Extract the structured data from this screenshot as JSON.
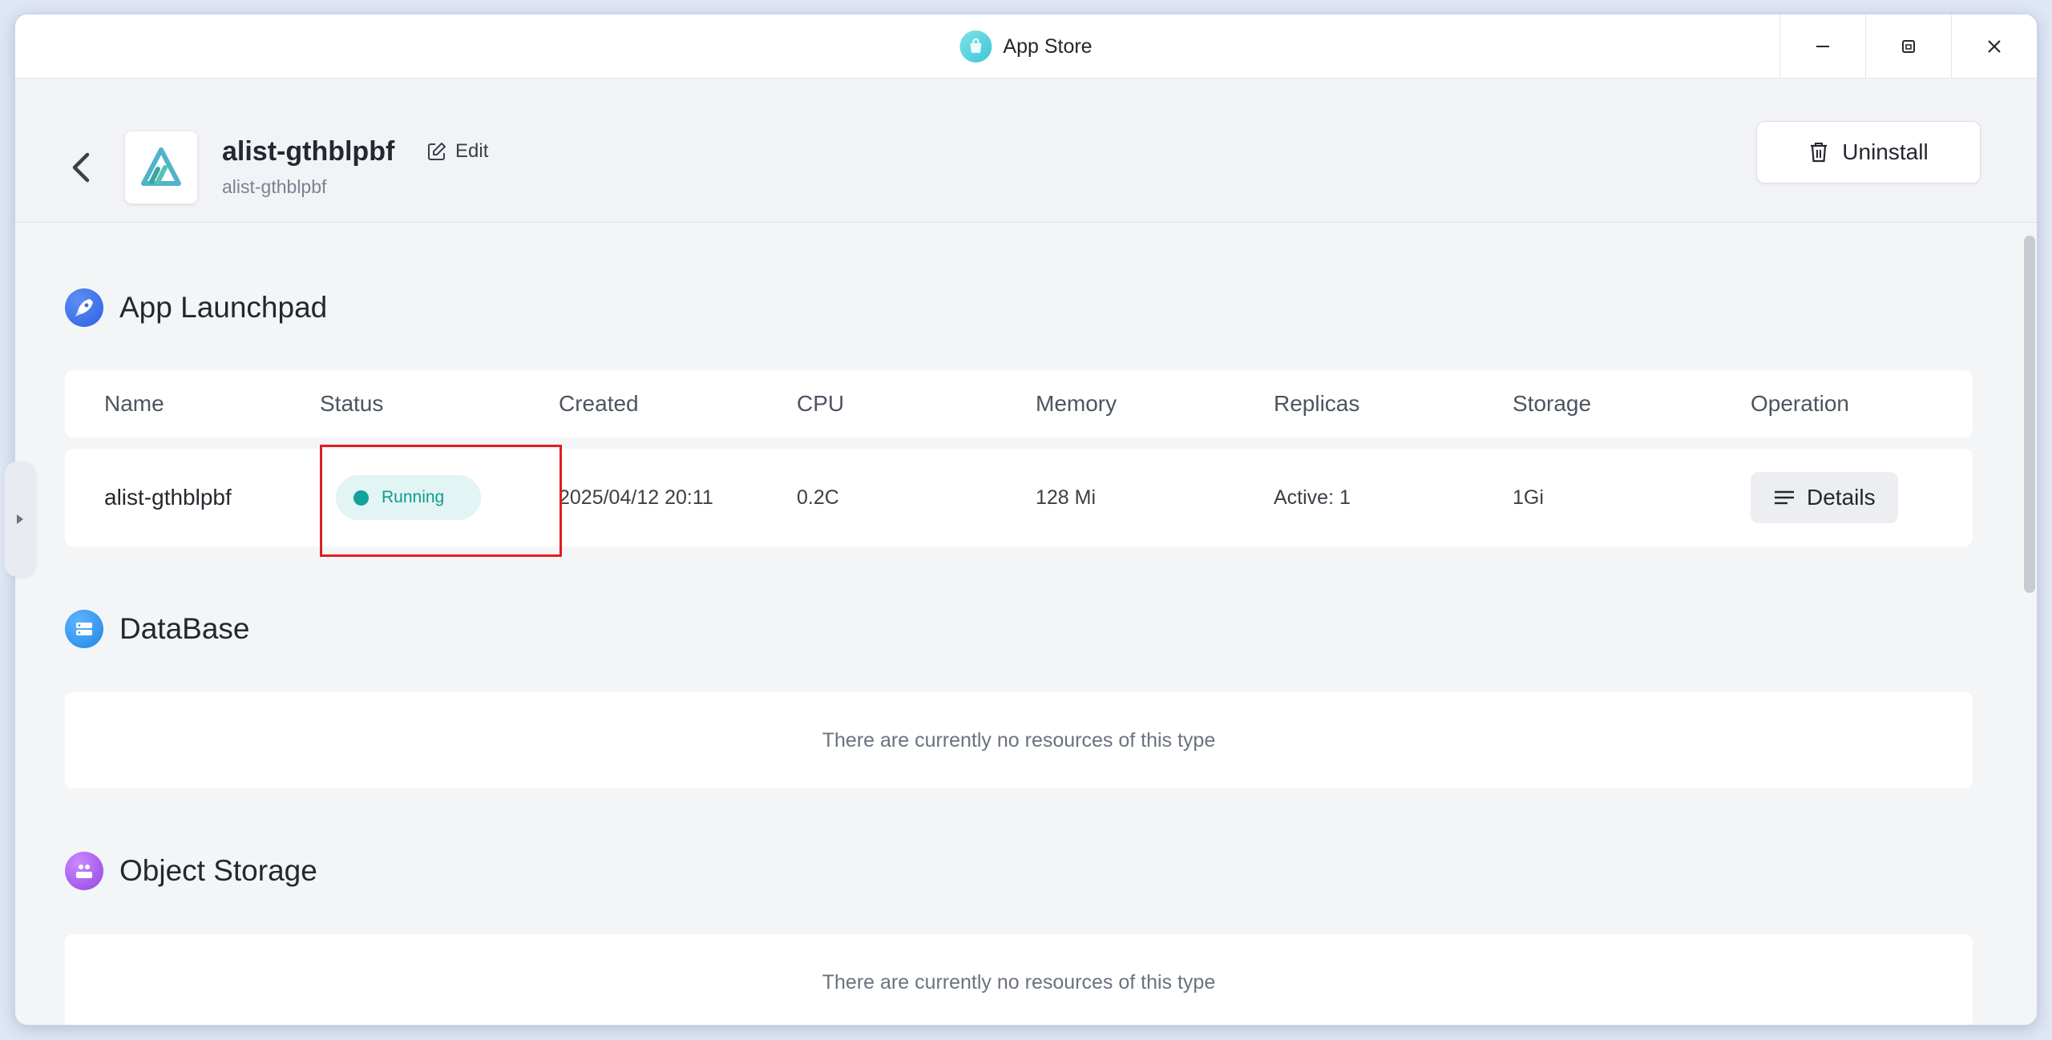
{
  "window": {
    "title": "App Store",
    "icon": "shopping-bag-icon"
  },
  "header": {
    "app_name": "alist-gthblpbf",
    "app_subtitle": "alist-gthblpbf",
    "edit_label": "Edit",
    "uninstall_label": "Uninstall"
  },
  "launchpad": {
    "title": "App Launchpad",
    "columns": [
      "Name",
      "Status",
      "Created",
      "CPU",
      "Memory",
      "Replicas",
      "Storage",
      "Operation"
    ],
    "rows": [
      {
        "name": "alist-gthblpbf",
        "status": "Running",
        "created": "2025/04/12 20:11",
        "cpu": "0.2C",
        "memory": "128 Mi",
        "replicas": "Active: 1",
        "storage": "1Gi",
        "operation": "Details"
      }
    ]
  },
  "database": {
    "title": "DataBase",
    "empty_text": "There are currently no resources of this type"
  },
  "object_storage": {
    "title": "Object Storage",
    "empty_text": "There are currently no resources of this type"
  },
  "colors": {
    "status_running": "#10a19a",
    "highlight": "#e01e1e",
    "launchpad_icon": "#3b6fe6",
    "database_icon": "#2f8fe8",
    "object_storage_icon": "#a25be6"
  }
}
